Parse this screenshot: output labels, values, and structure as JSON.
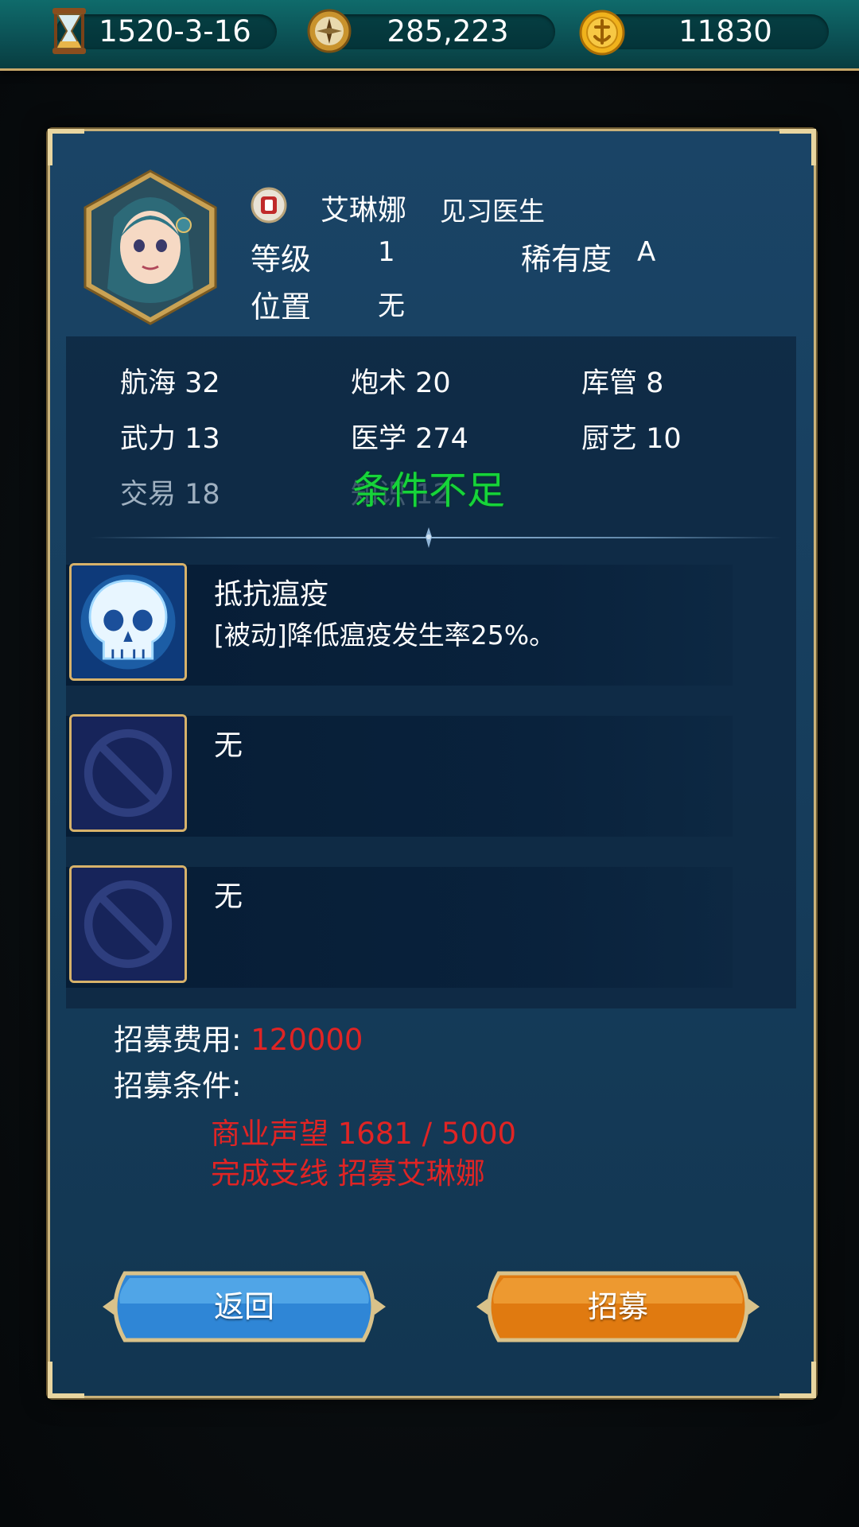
{
  "topbar": {
    "date": "1520-3-16",
    "reputation": "285,223",
    "coins": "11830"
  },
  "officer": {
    "name": "艾琳娜",
    "title": "见习医生",
    "level_label": "等级",
    "level": "1",
    "rarity_label": "稀有度",
    "rarity": "A",
    "position_label": "位置",
    "position": "无"
  },
  "stats": [
    {
      "label": "航海 32"
    },
    {
      "label": "炮术 20"
    },
    {
      "label": "库管 8"
    },
    {
      "label": "武力 13"
    },
    {
      "label": "医学 274"
    },
    {
      "label": "厨艺 10"
    },
    {
      "label": "交易 18"
    },
    {
      "label": "知识 12"
    }
  ],
  "warning": "条件不足",
  "skills": [
    {
      "name": "抵抗瘟疫",
      "desc": "[被动]降低瘟疫发生率25%。",
      "icon": "skull-icon"
    },
    {
      "name": "无",
      "desc": "",
      "icon": "empty-slot-icon"
    },
    {
      "name": "无",
      "desc": "",
      "icon": "empty-slot-icon"
    }
  ],
  "recruit": {
    "cost_label": "招募费用:",
    "cost_value": "120000",
    "condition_label": "招募条件:",
    "requirements": [
      "商业声望 1681 / 5000",
      "完成支线 招募艾琳娜"
    ]
  },
  "buttons": {
    "back": "返回",
    "recruit": "招募"
  },
  "colors": {
    "accent_gold": "#c9b27a",
    "warning_green": "#16d43a",
    "requirement_red": "#e02424",
    "back_blue": "#2f86d6",
    "recruit_orange": "#e07a10"
  }
}
